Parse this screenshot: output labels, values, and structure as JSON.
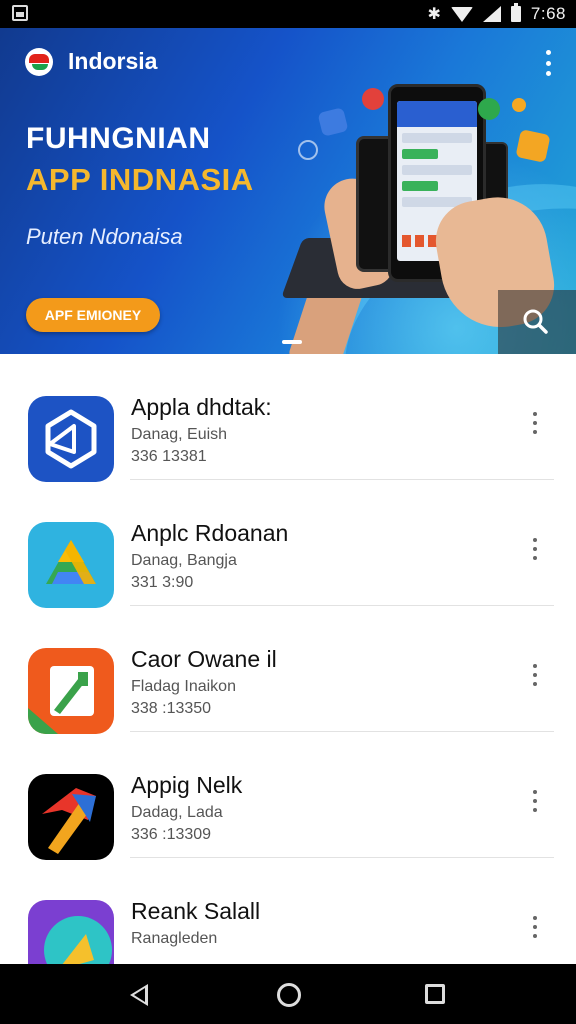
{
  "status_bar": {
    "time": "7:68",
    "icons": [
      "photo-icon",
      "bluetooth-icon",
      "wifi-icon",
      "signal-icon",
      "battery-icon"
    ]
  },
  "header": {
    "brand": "Indorsia",
    "menu_icon": "more-vert-icon"
  },
  "hero": {
    "title_line1": "FUHNGNIAN",
    "title_line2": "APP INDNASIA",
    "subtitle": "Puten Ndonaisa",
    "button_label": "APF EMIONEY",
    "search_icon": "search-icon",
    "colors": {
      "title_accent": "#f5b82e",
      "button": "#f39a1a",
      "background": "#1553c9"
    }
  },
  "apps": [
    {
      "name": "Appla dhdtak:",
      "developer": "Danag, Euish",
      "meta": "336 13381",
      "icon": "cube-app-icon",
      "colors": [
        "#1d53c4",
        "#ffffff"
      ]
    },
    {
      "name": "Anplc Rdoanan",
      "developer": "Danag, Bangja",
      "meta": "331 3:90",
      "icon": "triangle-app-icon",
      "colors": [
        "#2fb3e0",
        "#34a853",
        "#fbbc05",
        "#4285f4"
      ]
    },
    {
      "name": "Caor Owane il",
      "developer": "Fladag Inaikon",
      "meta": "338 :13350",
      "icon": "folder-app-icon",
      "colors": [
        "#ef5a1d",
        "#3aa24a"
      ]
    },
    {
      "name": "Appig Nelk",
      "developer": "Dadag, Lada",
      "meta": "336 :13309",
      "icon": "arrow-app-icon",
      "colors": [
        "#000000",
        "#e8352a",
        "#f2a51e"
      ]
    },
    {
      "name": "Reank Salall",
      "developer": "Ranagleden",
      "meta": "",
      "icon": "play-app-icon",
      "colors": [
        "#7b3fd1",
        "#2ec4c6",
        "#f5c02c"
      ]
    }
  ],
  "nav_bar": {
    "buttons": [
      "back-icon",
      "home-icon",
      "recents-icon"
    ]
  }
}
